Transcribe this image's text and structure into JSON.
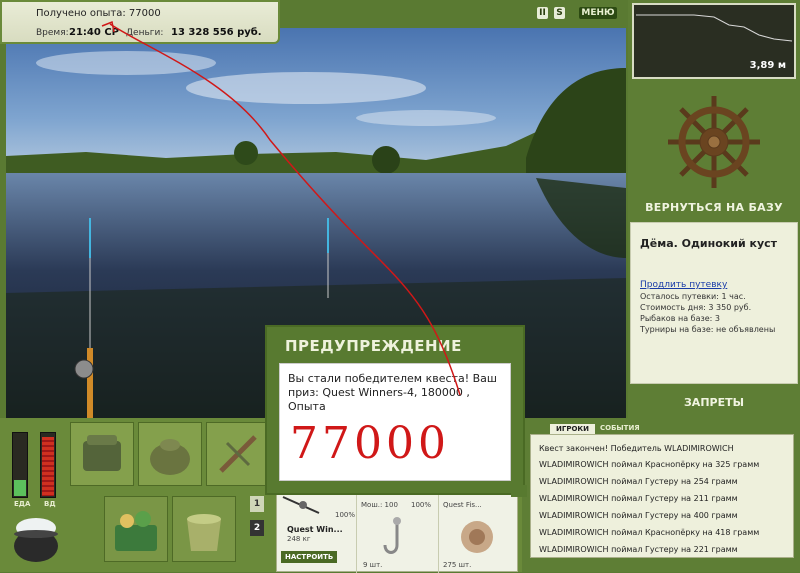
{
  "hud": {
    "exp_text": "Получено опыта: 77000",
    "time_label": "Время:",
    "time_value": "21:40 СР",
    "money_label": "Деньги:",
    "money_value": "13 328 556 руб."
  },
  "top_icons": {
    "pause": "II",
    "sound": "S",
    "menu": "МЕНЮ"
  },
  "depth": {
    "value": "3,89 м"
  },
  "right_panel": {
    "back_to_base": "ВЕРНУТЬСЯ НА БАЗУ",
    "location_title": "Дёма. Одинокий куст",
    "extend_link": "Продлить путевку",
    "lines": [
      "Осталось путевки: 1 час.",
      "Стоимость дня: 3 350 руб.",
      "Рыбаков на базе: 3",
      "Турниры на базе: не объявлены"
    ],
    "bans": "ЗАПРЕТЫ"
  },
  "meters": {
    "food_label": "ЕДА",
    "food_level": 0.25,
    "vodka_label": "ВД",
    "vodka_level": 0.95
  },
  "inventory_pages": [
    "1",
    "2"
  ],
  "item_bar": {
    "rod_name": "Quest Win...",
    "rod_weight": "248 кг",
    "rod_pct": "100%",
    "setup_button": "НАСТРОИТЬ",
    "slot2_header": "Мош.: 100",
    "slot2_pct": "100%",
    "slot2_count": "9 шт.",
    "slot3_header": "Quest Fis...",
    "slot3_count": "275 шт."
  },
  "events": {
    "tabs": [
      "ИГРОКИ",
      "СОБЫТИЯ"
    ],
    "rows": [
      "Квест закончен! Победитель WLADIMIROWICH",
      "WLADIMIROWICH поймал Краснопёрку на 325 грамм",
      "WLADIMIROWICH поймал Густеру на 254 грамм",
      "WLADIMIROWICH поймал Густеру на 211 грамм",
      "WLADIMIROWICH поймал Густеру на 400 грамм",
      "WLADIMIROWICH поймал Краснопёрку на 418 грамм",
      "WLADIMIROWICH поймал Густеру на 221 грамм"
    ]
  },
  "dialog": {
    "title": "ПРЕДУПРЕЖДЕНИЕ",
    "message": "Вы стали победителем квеста! Ваш приз: Quest Winners-4, 180000 , Опыта",
    "handwritten": "77000"
  }
}
